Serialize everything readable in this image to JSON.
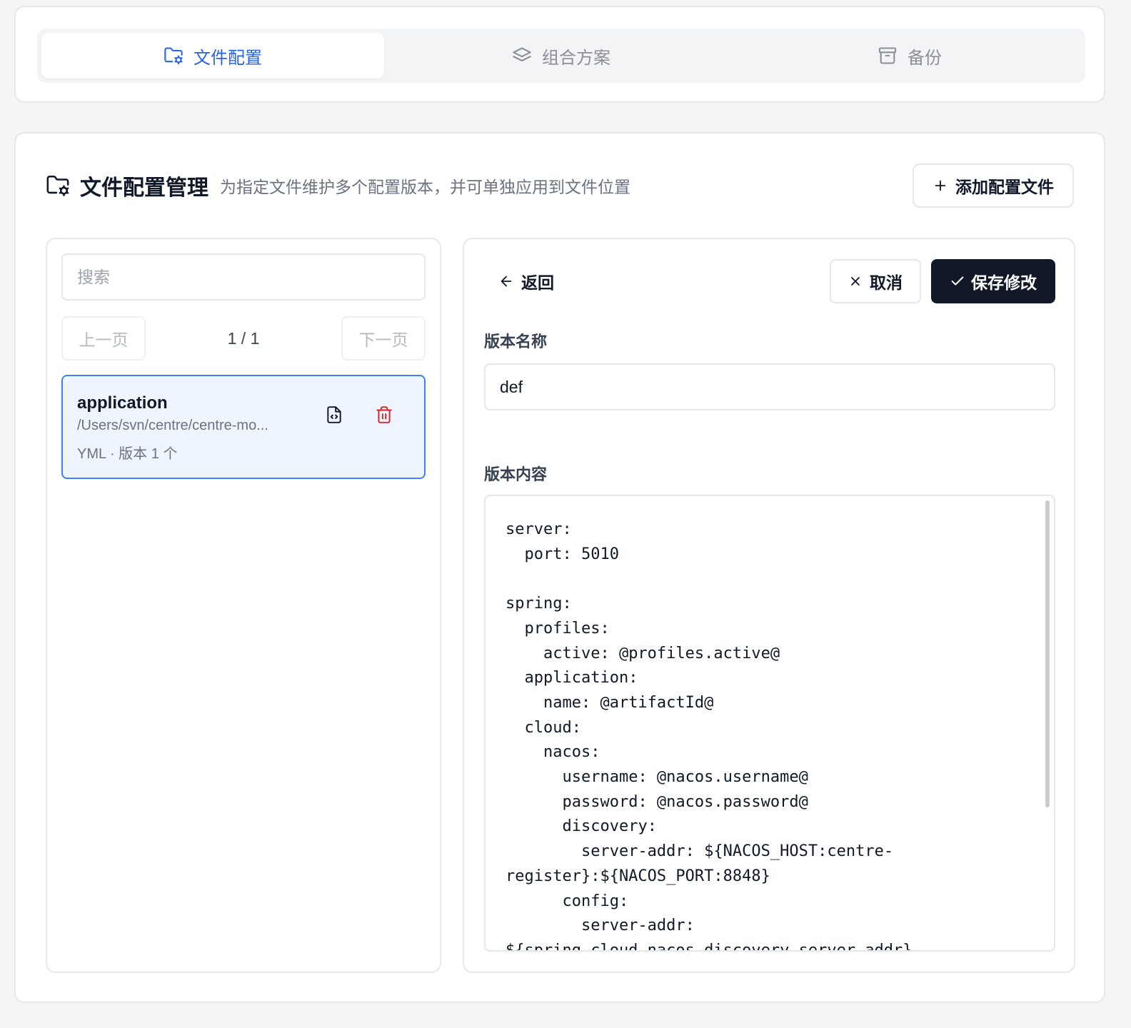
{
  "tabs": [
    {
      "label": "文件配置",
      "icon": "folder-gear-icon",
      "active": true
    },
    {
      "label": "组合方案",
      "icon": "layers-icon",
      "active": false
    },
    {
      "label": "备份",
      "icon": "archive-icon",
      "active": false
    }
  ],
  "header": {
    "title": "文件配置管理",
    "description": "为指定文件维护多个配置版本，并可单独应用到文件位置",
    "add_button": "添加配置文件"
  },
  "left": {
    "search_placeholder": "搜索",
    "prev_label": "上一页",
    "next_label": "下一页",
    "page_info": "1 / 1",
    "files": [
      {
        "name": "application",
        "path": "/Users/svn/centre/centre-mo...",
        "meta": "YML · 版本 1 个"
      }
    ]
  },
  "editor": {
    "back_label": "返回",
    "cancel_label": "取消",
    "save_label": "保存修改",
    "name_label": "版本名称",
    "name_value": "def",
    "content_label": "版本内容",
    "content": "server:\n  port: 5010\n\nspring:\n  profiles:\n    active: @profiles.active@\n  application:\n    name: @artifactId@\n  cloud:\n    nacos:\n      username: @nacos.username@\n      password: @nacos.password@\n      discovery:\n        server-addr: ${NACOS_HOST:centre-register}:${NACOS_PORT:8848}\n      config:\n        server-addr: ${spring.cloud.nacos.discovery.server-addr}"
  },
  "colors": {
    "accent": "#2563eb",
    "danger": "#dc2626",
    "primary_button": "#111827"
  }
}
